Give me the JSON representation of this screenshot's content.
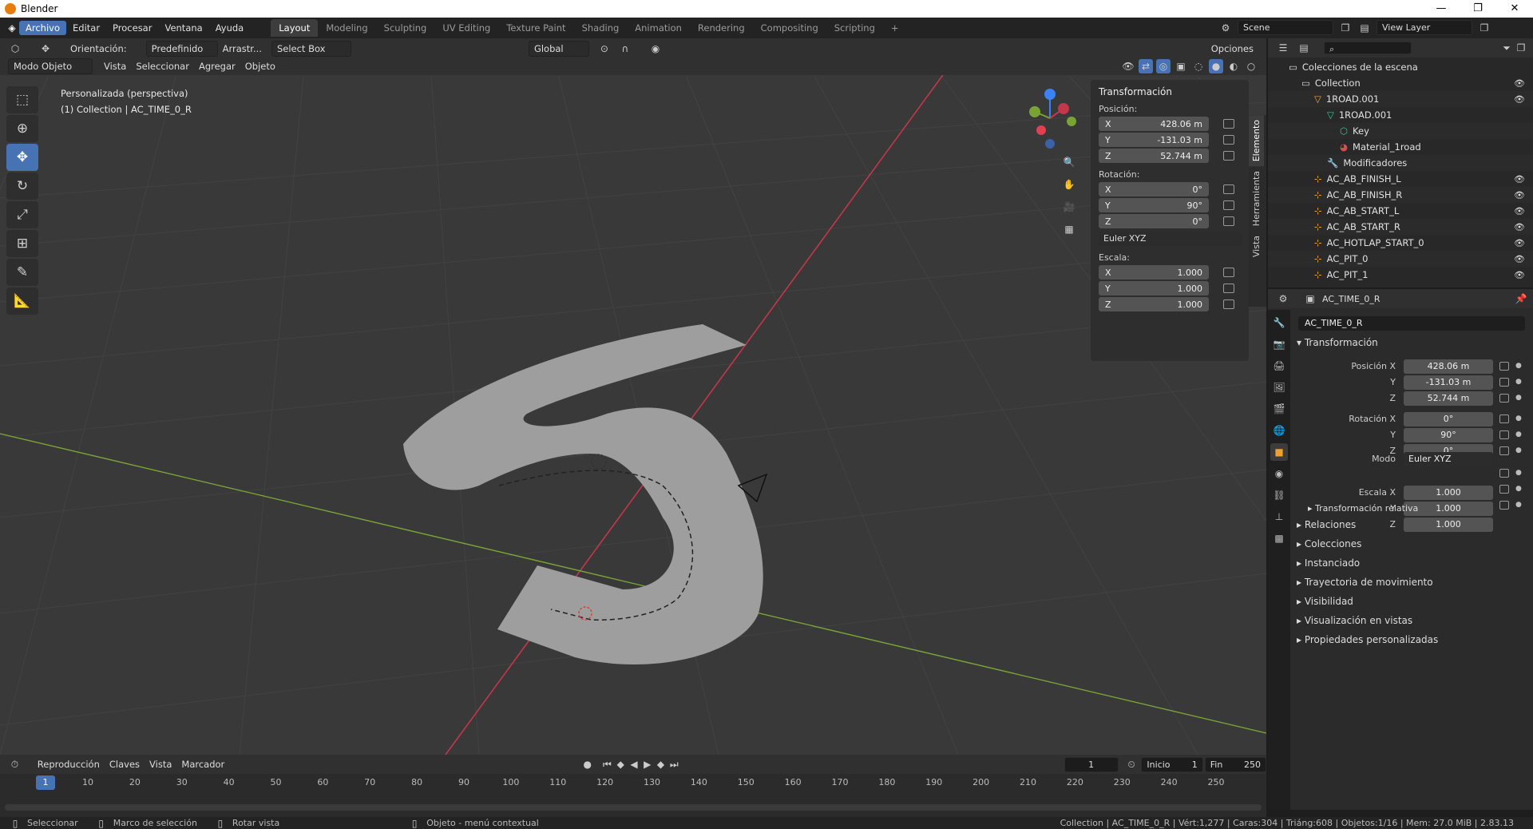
{
  "window": {
    "title": "Blender",
    "minimize": "—",
    "maximize": "❐",
    "close": "✕"
  },
  "topbar": {
    "menus": [
      "Archivo",
      "Editar",
      "Procesar",
      "Ventana",
      "Ayuda"
    ],
    "workspaces": [
      "Layout",
      "Modeling",
      "Sculpting",
      "UV Editing",
      "Texture Paint",
      "Shading",
      "Animation",
      "Rendering",
      "Compositing",
      "Scripting"
    ],
    "add_workspace": "+",
    "scene": "Scene",
    "view_layer": "View Layer"
  },
  "viewport_header": {
    "orientation_label": "Orientación:",
    "orientation_value": "Predefinido",
    "drag_label": "Arrastr...",
    "select_mode": "Select Box",
    "transform_orientation": "Global",
    "options": "Opciones",
    "mode": "Modo Objeto",
    "menus": [
      "Vista",
      "Seleccionar",
      "Agregar",
      "Objeto"
    ]
  },
  "viewport": {
    "view_name": "Personalizada (perspectiva)",
    "collection_info": "(1) Collection | AC_TIME_0_R",
    "colors": {
      "grid_bg": "#393939",
      "x_axis": "#c2374a",
      "y_axis": "#7aa336",
      "mesh": "#9e9e9e"
    }
  },
  "npanel": {
    "title": "Transformación",
    "position_label": "Posición:",
    "position": [
      {
        "axis": "X",
        "value": "428.06 m"
      },
      {
        "axis": "Y",
        "value": "-131.03 m"
      },
      {
        "axis": "Z",
        "value": "52.744 m"
      }
    ],
    "rotation_label": "Rotación:",
    "rotation": [
      {
        "axis": "X",
        "value": "0°"
      },
      {
        "axis": "Y",
        "value": "90°"
      },
      {
        "axis": "Z",
        "value": "0°"
      }
    ],
    "rotation_mode": "Euler XYZ",
    "scale_label": "Escala:",
    "scale": [
      {
        "axis": "X",
        "value": "1.000"
      },
      {
        "axis": "Y",
        "value": "1.000"
      },
      {
        "axis": "Z",
        "value": "1.000"
      }
    ],
    "tabs": [
      "Elemento",
      "Herramienta",
      "Vista"
    ]
  },
  "outliner": {
    "root": "Colecciones de la escena",
    "items": [
      {
        "name": "Collection",
        "depth": 1,
        "icon": "collection-icon",
        "eye": true
      },
      {
        "name": "1ROAD.001",
        "depth": 2,
        "icon": "mesh-object-icon",
        "eye": true
      },
      {
        "name": "1ROAD.001",
        "depth": 3,
        "icon": "mesh-data-icon",
        "eye": false
      },
      {
        "name": "Key",
        "depth": 4,
        "icon": "shape-key-icon",
        "eye": false
      },
      {
        "name": "Material_1road",
        "depth": 4,
        "icon": "material-icon",
        "eye": false
      },
      {
        "name": "Modificadores",
        "depth": 3,
        "icon": "wrench-icon",
        "eye": false
      },
      {
        "name": "AC_AB_FINISH_L",
        "depth": 2,
        "icon": "empty-icon",
        "eye": true
      },
      {
        "name": "AC_AB_FINISH_R",
        "depth": 2,
        "icon": "empty-icon",
        "eye": true
      },
      {
        "name": "AC_AB_START_L",
        "depth": 2,
        "icon": "empty-icon",
        "eye": true
      },
      {
        "name": "AC_AB_START_R",
        "depth": 2,
        "icon": "empty-icon",
        "eye": true
      },
      {
        "name": "AC_HOTLAP_START_0",
        "depth": 2,
        "icon": "empty-icon",
        "eye": true
      },
      {
        "name": "AC_PIT_0",
        "depth": 2,
        "icon": "empty-icon",
        "eye": true
      },
      {
        "name": "AC_PIT_1",
        "depth": 2,
        "icon": "empty-icon",
        "eye": true
      }
    ]
  },
  "properties": {
    "object_header": "AC_TIME_0_R",
    "object_name": "AC_TIME_0_R",
    "section": "Transformación",
    "pos_labels": [
      "Posición X",
      "Y",
      "Z"
    ],
    "pos_values": [
      "428.06 m",
      "-131.03 m",
      "52.744 m"
    ],
    "rot_labels": [
      "Rotación X",
      "Y",
      "Z"
    ],
    "rot_values": [
      "0°",
      "90°",
      "0°"
    ],
    "mode_label": "Modo",
    "mode_value": "Euler XYZ",
    "scale_labels": [
      "Escala X",
      "Y",
      "Z"
    ],
    "scale_values": [
      "1.000",
      "1.000",
      "1.000"
    ],
    "sub_relative": "Transformación relativa",
    "panels": [
      "Relaciones",
      "Colecciones",
      "Instanciado",
      "Trayectoria de movimiento",
      "Visibilidad",
      "Visualización en vistas",
      "Propiedades personalizadas"
    ]
  },
  "timeline": {
    "menus": [
      "Reproducción",
      "Claves",
      "Vista",
      "Marcador"
    ],
    "current_frame": "1",
    "start_label": "Inicio",
    "start_value": "1",
    "end_label": "Fin",
    "end_value": "250",
    "ticks": [
      "1",
      "10",
      "20",
      "30",
      "40",
      "50",
      "60",
      "70",
      "80",
      "90",
      "100",
      "110",
      "120",
      "130",
      "140",
      "150",
      "160",
      "170",
      "180",
      "190",
      "200",
      "210",
      "220",
      "230",
      "240",
      "250"
    ]
  },
  "statusbar": {
    "left": [
      "Seleccionar",
      "Marco de selección",
      "Rotar vista",
      "Objeto - menú contextual"
    ],
    "right": "Collection | AC_TIME_0_R | Vért:1,277 | Caras:304 | Triáng:608 | Objetos:1/16 | Mem: 27.0 MiB | 2.83.13"
  }
}
